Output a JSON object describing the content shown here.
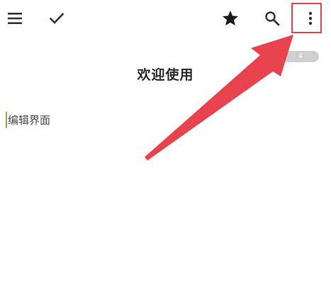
{
  "toolbar": {
    "icons": [
      "menu-icon",
      "check-icon",
      "star-icon",
      "search-icon",
      "more-vertical-icon"
    ]
  },
  "page": {
    "title": "欢迎使用",
    "count_badge": "4"
  },
  "editor": {
    "text": "编辑界面"
  },
  "annotation": {
    "color": "#e8424f"
  }
}
